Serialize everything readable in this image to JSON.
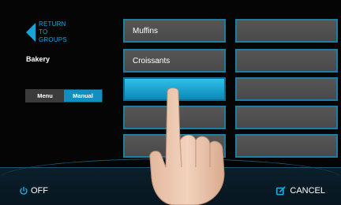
{
  "nav": {
    "back_line1": "RETURN TO",
    "back_line2": "GROUPS"
  },
  "group": {
    "title": "Bakery"
  },
  "mode": {
    "menu_label": "Menu",
    "manual_label": "Manual",
    "selected": "Manual"
  },
  "tiles": {
    "left": [
      "Muffins",
      "Croissants",
      "",
      "",
      ""
    ],
    "right": [
      "",
      "",
      "",
      "",
      ""
    ],
    "selected": "left-2"
  },
  "footer": {
    "off_label": "OFF",
    "cancel_label": "CANCEL"
  },
  "icons": {
    "back": "back-arrow-icon",
    "power": "power-icon",
    "edit": "edit-icon",
    "hand": "pointing-hand-icon"
  },
  "colors": {
    "accent": "#1aa3d6",
    "tile": "#4f4f4f",
    "tile_selected": "#1ea9d9",
    "background": "#050505"
  }
}
